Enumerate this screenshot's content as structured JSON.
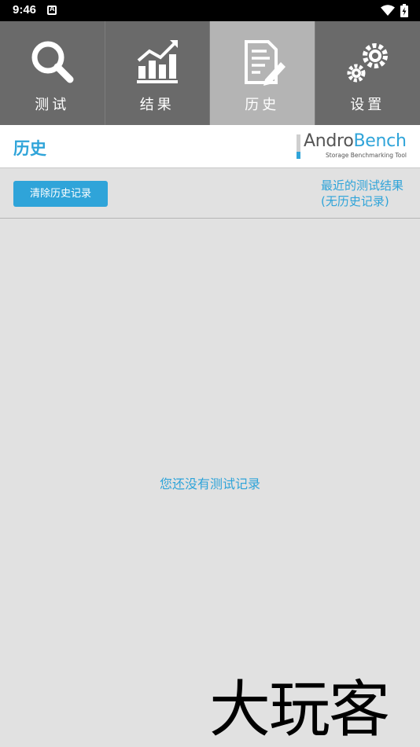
{
  "status_bar": {
    "time": "9:46"
  },
  "tabs": [
    {
      "label": "测试",
      "icon": "search-icon",
      "active": false
    },
    {
      "label": "结果",
      "icon": "chart-icon",
      "active": false
    },
    {
      "label": "历史",
      "icon": "document-edit-icon",
      "active": true
    },
    {
      "label": "设置",
      "icon": "gear-icon",
      "active": false
    }
  ],
  "header": {
    "title": "历史",
    "logo_part1": "Andro",
    "logo_part2": "Bench",
    "logo_tagline": "Storage Benchmarking Tool"
  },
  "actions": {
    "clear_button": "清除历史记录",
    "recent_line1": "最近的测试结果",
    "recent_line2": "(无历史记录)"
  },
  "empty_message": "您还没有测试记录",
  "watermark": "大玩客",
  "colors": {
    "accent": "#2fa4d9",
    "tab_bg": "#6a6a6a",
    "tab_active": "#b4b4b4",
    "page_bg": "#e1e1e1"
  }
}
